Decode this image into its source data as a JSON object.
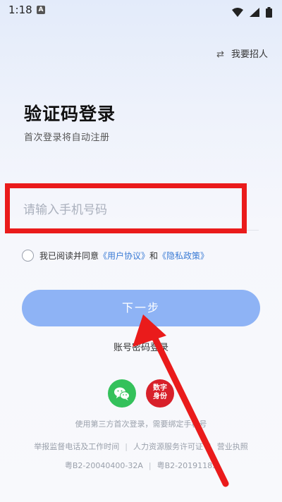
{
  "status_bar": {
    "time": "1:18",
    "notif_icon": "A"
  },
  "header": {
    "switch_label": "我要招人",
    "switch_icon": "swap-icon"
  },
  "login": {
    "title": "验证码登录",
    "subtitle": "首次登录将自动注册",
    "phone_placeholder": "请输入手机号码",
    "agree_prefix": "我已阅读并同意",
    "user_agreement": "《用户协议》",
    "and": "和",
    "privacy_policy": "《隐私政策》",
    "next_button": "下一步",
    "password_login": "账号密码登录"
  },
  "third_party": {
    "wechat_icon": "wechat-icon",
    "digital_id_label": "数字身份",
    "note": "使用第三方首次登录，需要绑定手机号"
  },
  "footer": {
    "report": "举报监督电话及工作时间",
    "hr_license": "人力资源服务许可证",
    "business_license": "营业执照",
    "icp1": "粤B2-20040400-32A",
    "icp2": "粤B2-20191183"
  },
  "colors": {
    "accent": "#8eb3f5",
    "link": "#3a7bd5",
    "annotation": "#ea1b1b",
    "wechat": "#34c15b",
    "digital_id": "#d8202a"
  }
}
